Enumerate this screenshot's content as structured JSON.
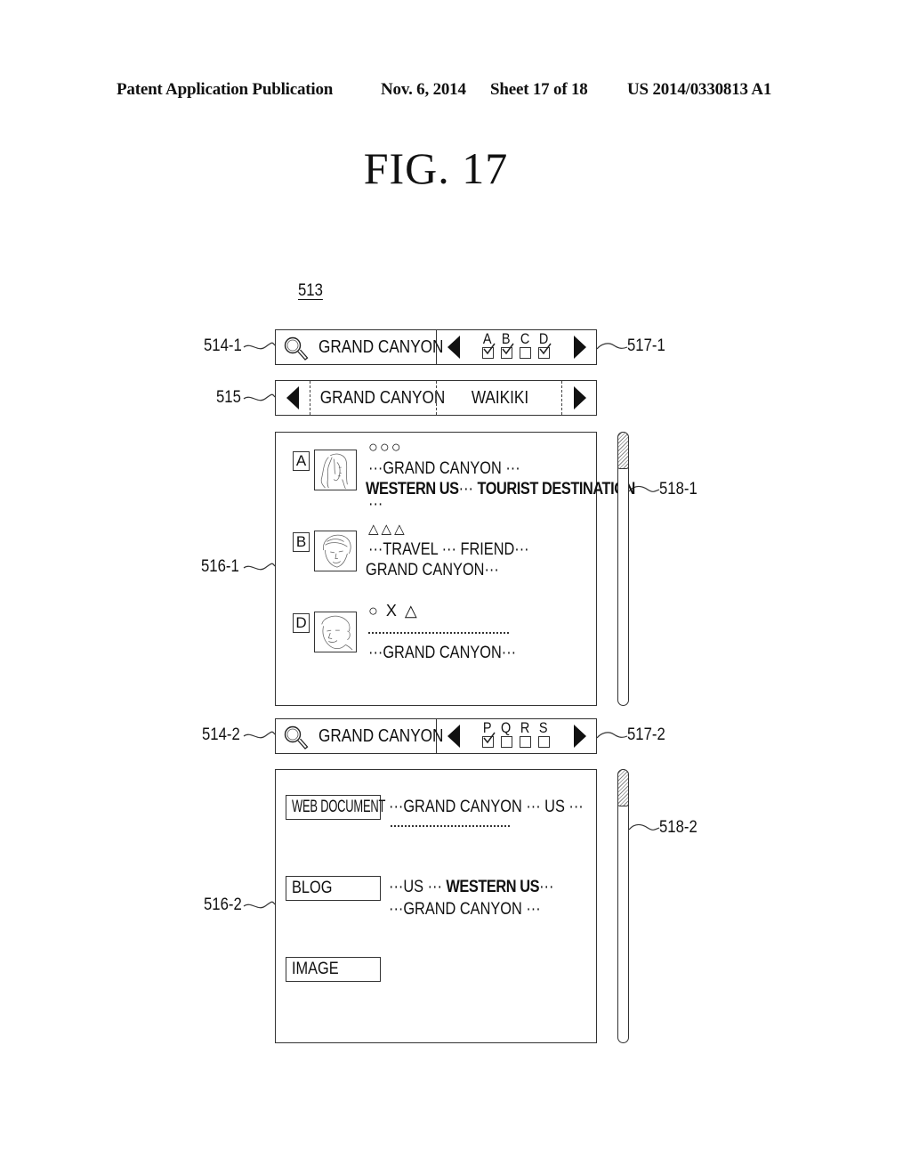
{
  "header": {
    "publication": "Patent Application Publication",
    "date": "Nov. 6, 2014",
    "sheet": "Sheet 17 of 18",
    "number": "US 2014/0330813 A1"
  },
  "figure": {
    "title": "FIG.  17"
  },
  "refs": {
    "screen": "513",
    "search_bar_1": "514-1",
    "keyword_tabs": "515",
    "results_1": "516-1",
    "filter_1": "517-1",
    "scrollbar_1": "518-1",
    "search_bar_2": "514-2",
    "results_2": "516-2",
    "filter_2": "517-2",
    "scrollbar_2": "518-2"
  },
  "search_bar_1": {
    "icon": "magnifier-icon",
    "query": "GRAND CANYON",
    "filters": [
      {
        "label": "A",
        "checked": true
      },
      {
        "label": "B",
        "checked": true
      },
      {
        "label": "C",
        "checked": false
      },
      {
        "label": "D",
        "checked": true
      }
    ]
  },
  "keyword_tabs": {
    "tabs": [
      "GRAND CANYON",
      "WAIKIKI"
    ]
  },
  "results_1": {
    "items": [
      {
        "badge": "A",
        "symbols": "○○○",
        "lines": [
          "···GRAND CANYON ···"
        ],
        "bold_line": {
          "bold1": "WESTERN US",
          "sep": "··· ",
          "bold2": "TOURIST DESTINATION"
        },
        "tail": "···"
      },
      {
        "badge": "B",
        "symbols": "△△△",
        "lines": [
          "···TRAVEL ··· FRIEND···",
          "GRAND CANYON···"
        ]
      },
      {
        "badge": "D",
        "symbols": "○ X △",
        "lines": [
          "···GRAND CANYON···"
        ]
      }
    ]
  },
  "search_bar_2": {
    "icon": "magnifier-icon",
    "query": "GRAND CANYON",
    "filters": [
      {
        "label": "P",
        "checked": true
      },
      {
        "label": "Q",
        "checked": false
      },
      {
        "label": "R",
        "checked": false
      },
      {
        "label": "S",
        "checked": false
      }
    ]
  },
  "results_2": {
    "items": [
      {
        "type": "WEB DOCUMENT",
        "line1": "···GRAND CANYON ··· US ···"
      },
      {
        "type": "BLOG",
        "line1_pre": "···US ··· ",
        "line1_bold": "WESTERN US",
        "line1_post": "···",
        "line2": "···GRAND CANYON ···"
      },
      {
        "type": "IMAGE"
      }
    ]
  },
  "scrollbars": {
    "scrollbar_1_position": 0,
    "scrollbar_2_position": 0
  }
}
